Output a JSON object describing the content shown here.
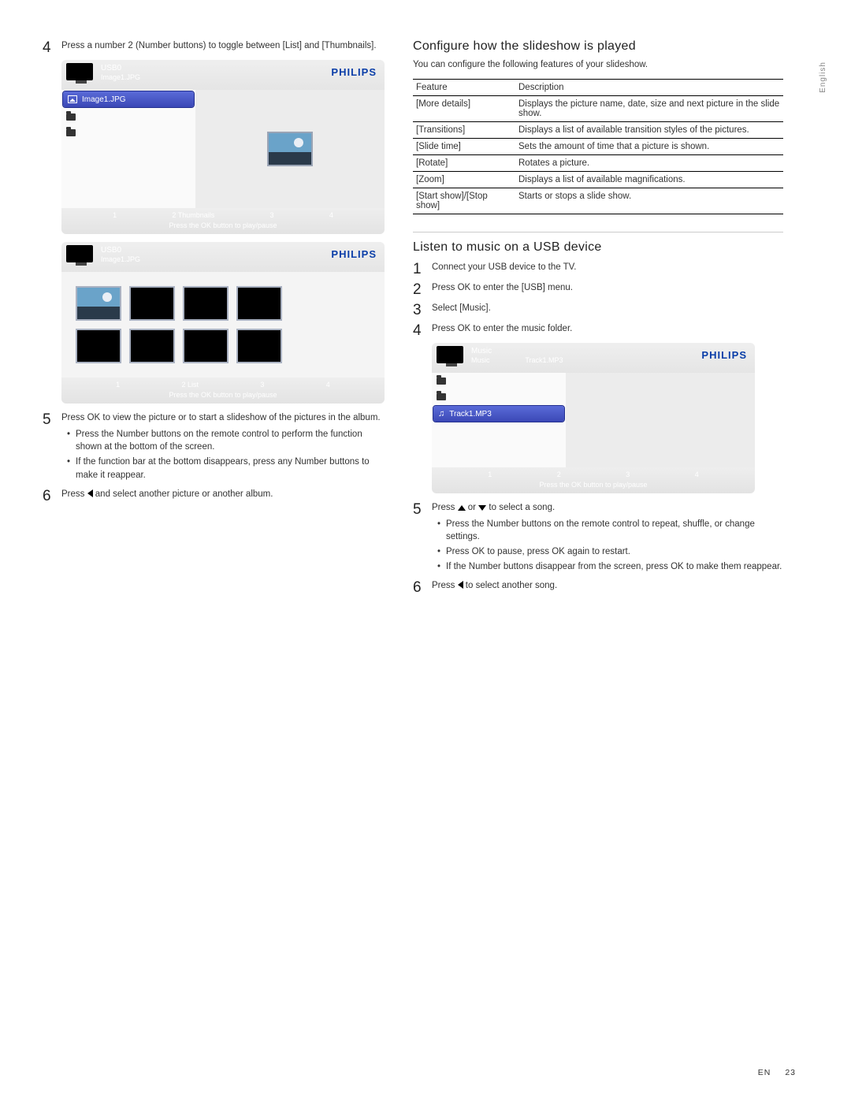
{
  "lang_tab": "English",
  "footer": {
    "lang": "EN",
    "page": "23"
  },
  "left": {
    "steps": {
      "s4": "Press a number 2 (Number buttons) to toggle between [List] and [Thumbnails].",
      "s5": "Press OK to view the picture or to start a slideshow of the pictures in the album.",
      "s5_bullets": [
        "Press the Number buttons on the remote control to perform the function shown at the bottom of the screen.",
        "If the function bar at the bottom disappears, press any Number buttons to make it reappear."
      ],
      "s6_pre": "Press ",
      "s6_post": " and select another picture or another album."
    },
    "panel_list": {
      "title1": "USB0",
      "title2": "Image1.JPG",
      "brand": "PHILIPS",
      "selected": "Image1.JPG",
      "fn": [
        "1",
        "2  Thumbnails",
        "3",
        "4"
      ],
      "hint": "Press the OK button to play/pause"
    },
    "panel_thumbs": {
      "title1": "USB0",
      "title2": "Image1.JPG",
      "brand": "PHILIPS",
      "fn": [
        "1",
        "2  List",
        "3",
        "4"
      ],
      "hint": "Press the OK button to play/pause"
    }
  },
  "right": {
    "section_configure": {
      "heading": "Conﬁgure how the slideshow is played",
      "intro": "You can conﬁgure the following features of your slideshow.",
      "th_feature": "Feature",
      "th_desc": "Description",
      "rows": [
        {
          "f": "[More details]",
          "d": "Displays the picture name, date, size and next picture in the slide show."
        },
        {
          "f": "[Transitions]",
          "d": "Displays a list of available transition styles of the pictures."
        },
        {
          "f": "[Slide time]",
          "d": "Sets the amount of time that a picture is shown."
        },
        {
          "f": "[Rotate]",
          "d": "Rotates a picture."
        },
        {
          "f": "[Zoom]",
          "d": "Displays a list of available magniﬁcations."
        },
        {
          "f": "[Start show]/[Stop show]",
          "d": "Starts or stops a slide show."
        }
      ]
    },
    "section_music": {
      "heading": "Listen to music on a USB device",
      "steps": {
        "s1": "Connect your USB device to the TV.",
        "s2": "Press OK to enter the [USB] menu.",
        "s3": "Select [Music].",
        "s4": "Press OK to enter the music folder.",
        "s5_pre": "Press ",
        "s5_mid": " or ",
        "s5_post": " to select a song.",
        "s5_bullets": [
          "Press the Number buttons on the remote control to repeat, shufﬂe, or change settings.",
          "Press OK to pause, press OK again to restart.",
          "If the Number buttons disappear from the screen, press OK to make them reappear."
        ],
        "s6_pre": "Press ",
        "s6_post": " to select another song."
      },
      "panel": {
        "title1": "Music",
        "title2a": "Music",
        "title2b": "Track1.MP3",
        "brand": "PHILIPS",
        "selected": "Track1.MP3",
        "fn": [
          "1",
          "2",
          "3",
          "4"
        ],
        "hint": "Press the OK button to play/pause"
      }
    }
  }
}
